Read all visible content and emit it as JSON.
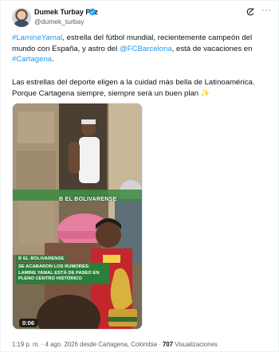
{
  "author": {
    "name": "Dumek Turbay Paz",
    "handle": "@dumek_turbay"
  },
  "tweet": {
    "p1_hashtag1": "#LamineYamal",
    "p1_text1": ", estrella del fútbol mundial, recientemente campeón del mundo con España, y astro del ",
    "p1_mention": "@FCBarcelona",
    "p1_text2": ", está de vacaciones en ",
    "p1_hashtag2": "#Cartagena",
    "p1_end": ".",
    "p2_line1": "Las estrellas del deporte eligen a la cuidad más bella de  Latinoamérica.",
    "p2_line2": "Porque Cartagena siempre, siempre será un buen plan ",
    "p2_emoji": "✨"
  },
  "media": {
    "watermark": "B  EL BOLIVARENSE",
    "caption_brand": "B  EL BOLIVARENSE",
    "caption": "SE ACABARON LOS RUMORES: LAMINE YAMAL ESTÁ DE PASEO EN PLENO CENTRO HISTÓRICO",
    "duration": "0:06"
  },
  "footer": {
    "time": "1:19 p. m.",
    "sep1": " · ",
    "date": "4 ago. 2026",
    "location": " desde Cartagena, Colombia",
    "sep2": " · ",
    "views_count": "707",
    "views_label": " Visualizaciones"
  },
  "colors": {
    "link": "#1d9bf0",
    "verified": "#1d9bf0",
    "caption_bg": "#2c7d3a",
    "secondary_text": "#536471"
  },
  "icons": [
    "verified-badge-icon",
    "grok-icon",
    "more-options-icon",
    "sparkles-emoji"
  ]
}
